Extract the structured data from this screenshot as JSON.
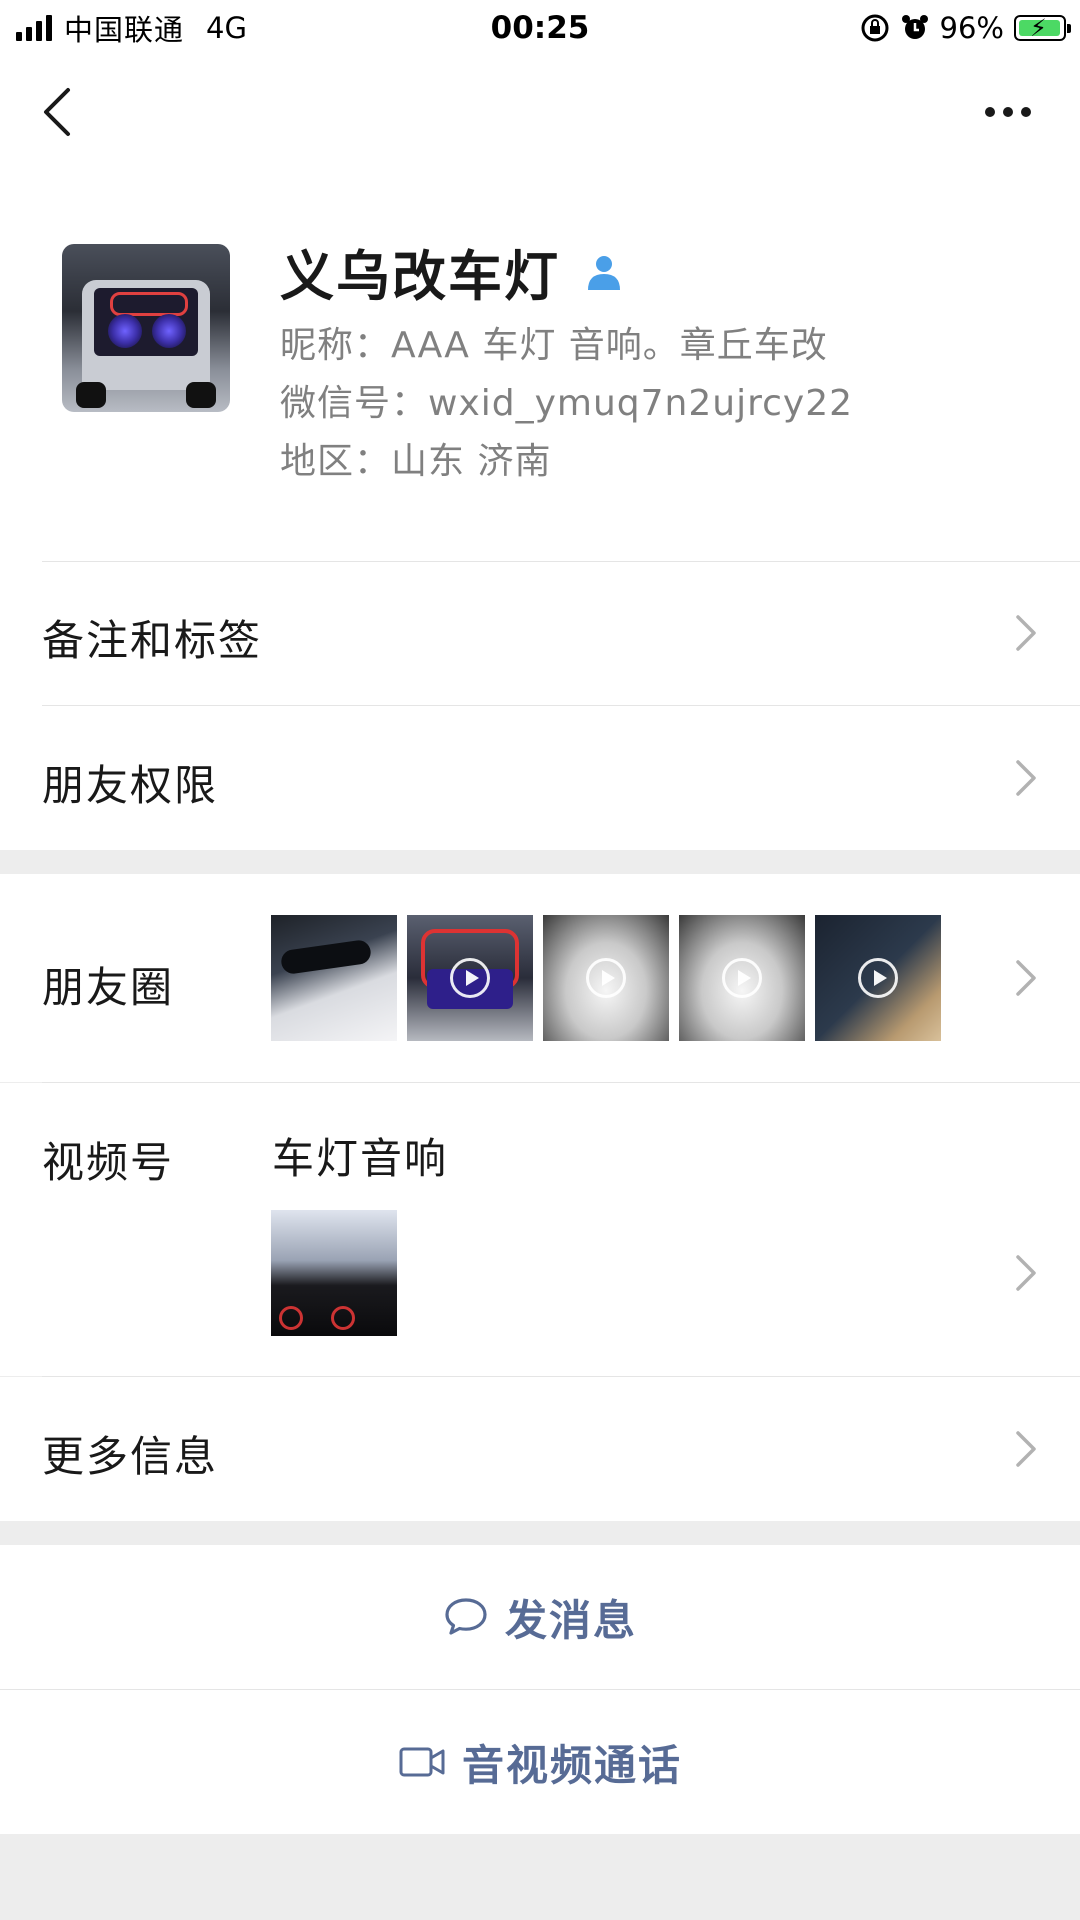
{
  "status_bar": {
    "carrier": "中国联通",
    "network": "4G",
    "time": "00:25",
    "battery": "96%",
    "battery_level": 0.96
  },
  "nav": {
    "back_icon": "chevron-left-icon",
    "more_icon": "more-horizontal-icon"
  },
  "profile": {
    "name": "义乌改车灯",
    "nickname": "昵称：AAA 车灯  音响。章丘车改",
    "wechat_id": "微信号：wxid_ymuq7n2ujrcy22",
    "region": "地区：山东 济南",
    "gender_icon": "person-icon"
  },
  "menu": {
    "remarks_tags": "备注和标签",
    "friend_permissions": "朋友权限",
    "moments": "朋友圈",
    "channels": "视频号",
    "channels_name": "车灯音响",
    "more_info": "更多信息"
  },
  "actions": {
    "send_message": "发消息",
    "video_call": "音视频通话"
  },
  "colors": {
    "link_blue": "#576b95",
    "page_bg": "#ededed",
    "battery_green": "#4cd964"
  }
}
